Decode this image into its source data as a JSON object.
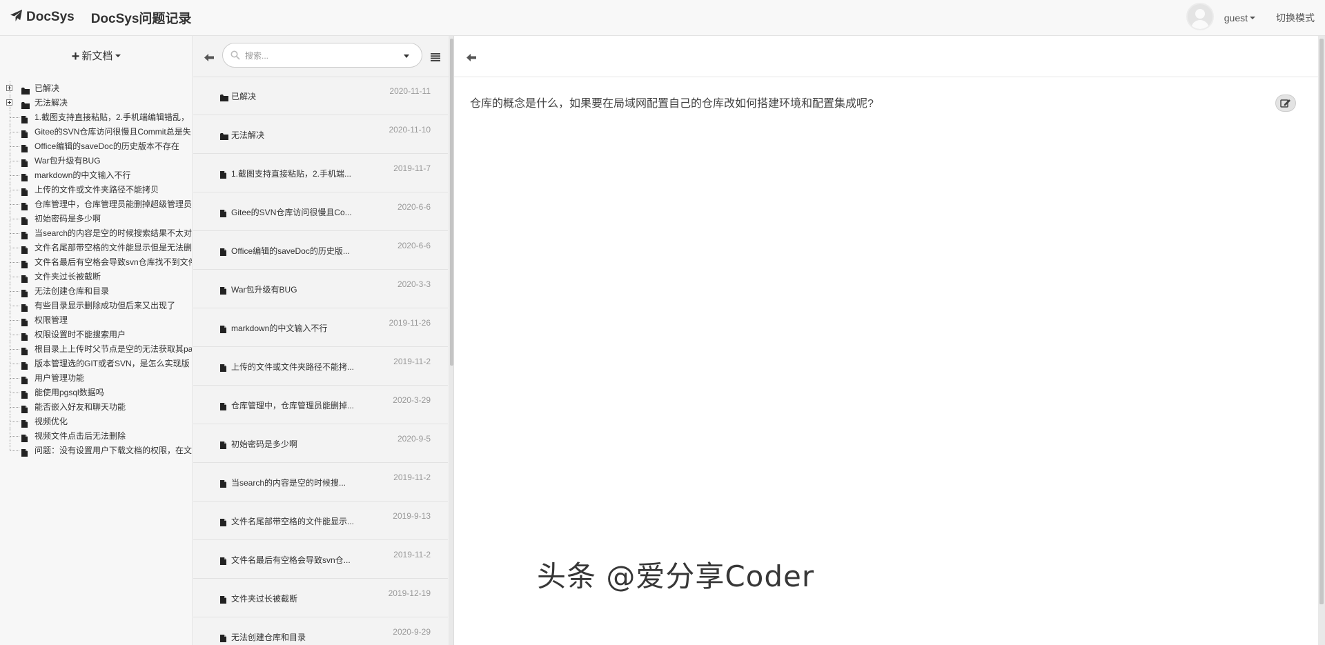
{
  "app": {
    "brand": "DocSys",
    "title": "DocSys问题记录"
  },
  "header": {
    "user": "guest",
    "switch_mode": "切换模式"
  },
  "sidebar": {
    "new_doc": "新文档",
    "tree": [
      {
        "label": "已解决",
        "type": "folder"
      },
      {
        "label": "无法解决",
        "type": "folder"
      },
      {
        "label": "1.截图支持直接粘贴，2.手机端编辑错乱，",
        "type": "file"
      },
      {
        "label": "Gitee的SVN仓库访问很慢且Commit总是失",
        "type": "file"
      },
      {
        "label": "Office编辑的saveDoc的历史版本不存在",
        "type": "file"
      },
      {
        "label": "War包升级有BUG",
        "type": "file"
      },
      {
        "label": "markdown的中文输入不行",
        "type": "file"
      },
      {
        "label": "上传的文件或文件夹路径不能拷贝",
        "type": "file"
      },
      {
        "label": "仓库管理中，仓库管理员能删掉超级管理员",
        "type": "file"
      },
      {
        "label": "初始密码是多少啊",
        "type": "file"
      },
      {
        "label": "当search的内容是空的时候搜索结果不太对",
        "type": "file"
      },
      {
        "label": "文件名尾部带空格的文件能显示但是无法删",
        "type": "file"
      },
      {
        "label": "文件名最后有空格会导致svn仓库找不到文件",
        "type": "file"
      },
      {
        "label": "文件夹过长被截断",
        "type": "file"
      },
      {
        "label": "无法创建仓库和目录",
        "type": "file"
      },
      {
        "label": "有些目录显示删除成功但后来又出现了",
        "type": "file"
      },
      {
        "label": "权限管理",
        "type": "file"
      },
      {
        "label": "权限设置时不能搜索用户",
        "type": "file"
      },
      {
        "label": "根目录上上传时父节点是空的无法获取其pa",
        "type": "file"
      },
      {
        "label": "版本管理选的GIT或者SVN，是怎么实现版",
        "type": "file"
      },
      {
        "label": "用户管理功能",
        "type": "file"
      },
      {
        "label": "能使用pgsql数据吗",
        "type": "file"
      },
      {
        "label": "能否嵌入好友和聊天功能",
        "type": "file"
      },
      {
        "label": "视频优化",
        "type": "file"
      },
      {
        "label": "视频文件点击后无法删除",
        "type": "file"
      },
      {
        "label": "问题：没有设置用户下载文档的权限，在文",
        "type": "file"
      }
    ]
  },
  "search": {
    "placeholder": "搜索..."
  },
  "doc_list": [
    {
      "name": "已解决",
      "date": "2020-11-11",
      "type": "folder"
    },
    {
      "name": "无法解决",
      "date": "2020-11-10",
      "type": "folder"
    },
    {
      "name": "1.截图支持直接粘贴，2.手机端...",
      "date": "2019-11-7",
      "type": "file"
    },
    {
      "name": "Gitee的SVN仓库访问很慢且Co...",
      "date": "2020-6-6",
      "type": "file"
    },
    {
      "name": "Office编辑的saveDoc的历史版...",
      "date": "2020-6-6",
      "type": "file"
    },
    {
      "name": "War包升级有BUG",
      "date": "2020-3-3",
      "type": "file"
    },
    {
      "name": "markdown的中文输入不行",
      "date": "2019-11-26",
      "type": "file"
    },
    {
      "name": "上传的文件或文件夹路径不能拷...",
      "date": "2019-11-2",
      "type": "file"
    },
    {
      "name": "仓库管理中，仓库管理员能删掉...",
      "date": "2020-3-29",
      "type": "file"
    },
    {
      "name": "初始密码是多少啊",
      "date": "2020-9-5",
      "type": "file"
    },
    {
      "name": "当search的内容是空的时候搜...",
      "date": "2019-11-2",
      "type": "file"
    },
    {
      "name": "文件名尾部带空格的文件能显示...",
      "date": "2019-9-13",
      "type": "file"
    },
    {
      "name": "文件名最后有空格会导致svn仓...",
      "date": "2019-11-2",
      "type": "file"
    },
    {
      "name": "文件夹过长被截断",
      "date": "2019-12-19",
      "type": "file"
    },
    {
      "name": "无法创建仓库和目录",
      "date": "2020-9-29",
      "type": "file"
    }
  ],
  "content": {
    "question": "仓库的概念是什么，如果要在局域网配置自己的仓库改如何搭建环境和配置集成呢?"
  },
  "watermark": "头条 @爱分享Coder"
}
